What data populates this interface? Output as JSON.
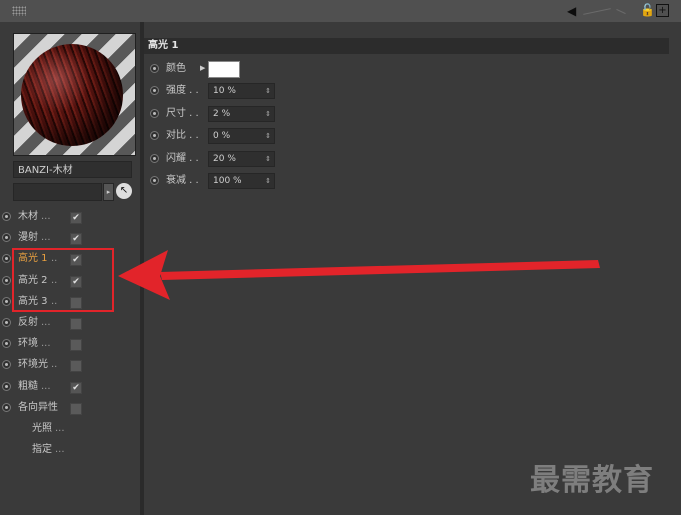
{
  "titlebar": {
    "icons": [
      "grip-icon",
      "back-arrow-icon",
      "lock-icon",
      "add-panel-icon"
    ],
    "back_symbol": "◀",
    "lock_symbol": "🔓",
    "plus_symbol": "+"
  },
  "material": {
    "name": "BANZI-木材",
    "field_value": "",
    "arrow_symbol": "▸",
    "pick_symbol": "↖"
  },
  "channels": [
    {
      "label": "木材",
      "dots": "...",
      "checked": true,
      "check": "✔"
    },
    {
      "label": "漫射",
      "dots": "...",
      "checked": true,
      "check": "✔"
    },
    {
      "label": "高光 1",
      "dots": "..",
      "checked": true,
      "check": "✔",
      "active": true
    },
    {
      "label": "高光 2",
      "dots": "..",
      "checked": true,
      "check": "✔"
    },
    {
      "label": "高光 3",
      "dots": "..",
      "checked": false,
      "check": ""
    },
    {
      "label": "反射",
      "dots": "...",
      "checked": false,
      "check": ""
    },
    {
      "label": "环境",
      "dots": "...",
      "checked": false,
      "check": ""
    },
    {
      "label": "环境光",
      "dots": "..",
      "checked": false,
      "check": ""
    },
    {
      "label": "粗糙",
      "dots": "...",
      "checked": true,
      "check": "✔"
    },
    {
      "label": "各向异性",
      "dots": "",
      "checked": false,
      "check": ""
    },
    {
      "label": "光照",
      "dots": "...",
      "no_control": true
    },
    {
      "label": "指定",
      "dots": "...",
      "no_control": true
    }
  ],
  "section": {
    "title": "高光 1",
    "color_label": "颜色",
    "color_value": "#ffffff",
    "props": [
      {
        "label": "强度 . .",
        "value": "10 %"
      },
      {
        "label": "尺寸 . .",
        "value": "2 %"
      },
      {
        "label": "对比 . .",
        "value": "0 %"
      },
      {
        "label": "闪耀 . .",
        "value": "20 %"
      },
      {
        "label": "衰减 . .",
        "value": "100 %"
      }
    ],
    "spin_symbol": "⇕"
  },
  "watermark": "最需教育",
  "colors": {
    "annotation_red": "#e2242a",
    "active_channel": "#e8a040",
    "panel_bg": "#3a3a3a"
  }
}
